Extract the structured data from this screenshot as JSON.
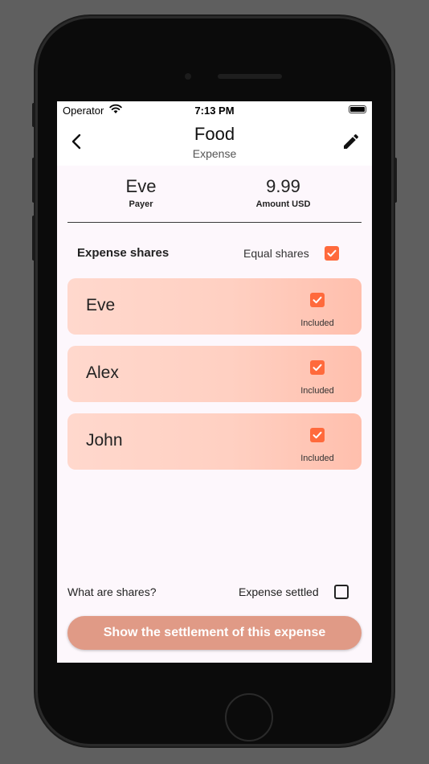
{
  "status_bar": {
    "carrier": "Operator",
    "time": "7:13 PM"
  },
  "nav": {
    "title": "Food",
    "subtitle": "Expense"
  },
  "summary": {
    "payer_value": "Eve",
    "payer_label": "Payer",
    "amount_value": "9.99",
    "amount_label": "Amount USD"
  },
  "shares": {
    "header": "Expense shares",
    "equal_label": "Equal shares",
    "equal_checked": true,
    "people": [
      {
        "name": "Eve",
        "included_label": "Included",
        "included": true
      },
      {
        "name": "Alex",
        "included_label": "Included",
        "included": true
      },
      {
        "name": "John",
        "included_label": "Included",
        "included": true
      }
    ]
  },
  "footer": {
    "what_are_shares": "What are shares?",
    "settled_label": "Expense settled",
    "settled_checked": false,
    "settlement_button": "Show the settlement of this expense"
  },
  "colors": {
    "accent": "#ff6a3c",
    "button": "#e09a86",
    "card": "#ffd0c2"
  }
}
